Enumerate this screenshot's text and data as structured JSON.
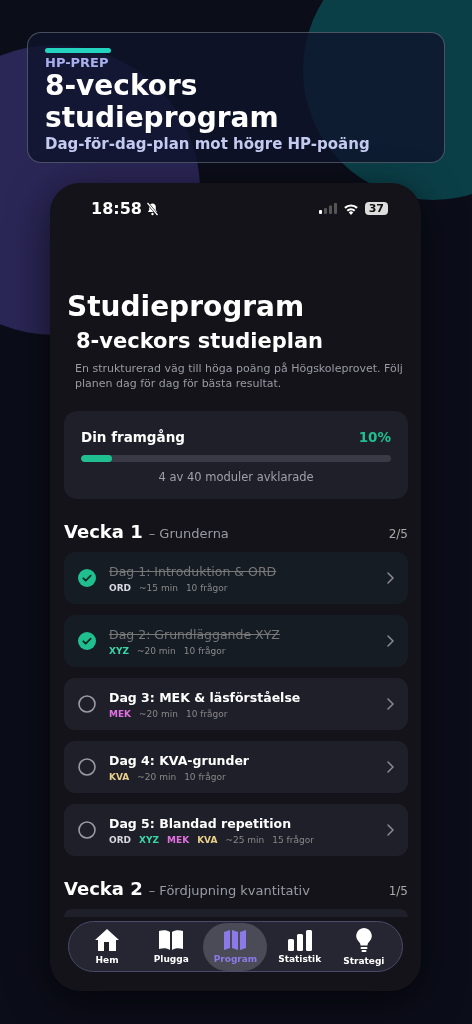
{
  "banner": {
    "eyebrow": "HP-PREP",
    "title": "8-veckors studieprogram",
    "subtitle": "Dag-för-dag-plan mot högre HP-poäng"
  },
  "status_bar": {
    "time": "18:58",
    "battery": "37"
  },
  "page": {
    "title": "Studieprogram",
    "heading": "8-veckors studieplan",
    "description": "En strukturerad väg till höga poäng på Högskoleprovet. Följ planen dag för dag för bästa resultat."
  },
  "progress": {
    "label": "Din framgång",
    "percent": "10%",
    "level": 0.1,
    "summary": "4 av 40 moduler avklarade"
  },
  "weeks": [
    {
      "title": "Vecka 1",
      "subtitle": "– Grunderna",
      "count": "2/5",
      "days": [
        {
          "title": "Dag 1: Introduktion & ORD",
          "done": true,
          "tags": [
            {
              "label": "ORD",
              "color": "#d8d8e0"
            }
          ],
          "duration": "~15 min",
          "questions": "10 frågor"
        },
        {
          "title": "Dag 2: Grundläggande XYZ",
          "done": true,
          "tags": [
            {
              "label": "XYZ",
              "color": "#3ad6a8"
            }
          ],
          "duration": "~20 min",
          "questions": "10 frågor"
        },
        {
          "title": "Dag 3: MEK & läsförståelse",
          "done": false,
          "tags": [
            {
              "label": "MEK",
              "color": "#e070e0"
            }
          ],
          "duration": "~20 min",
          "questions": "10 frågor"
        },
        {
          "title": "Dag 4: KVA-grunder",
          "done": false,
          "tags": [
            {
              "label": "KVA",
              "color": "#e8d08a"
            }
          ],
          "duration": "~20 min",
          "questions": "10 frågor"
        },
        {
          "title": "Dag 5: Blandad repetition",
          "done": false,
          "tags": [
            {
              "label": "ORD",
              "color": "#d8d8e0"
            },
            {
              "label": "XYZ",
              "color": "#3ad6a8"
            },
            {
              "label": "MEK",
              "color": "#e070e0"
            },
            {
              "label": "KVA",
              "color": "#e8d08a"
            }
          ],
          "duration": "~25 min",
          "questions": "15 frågor"
        }
      ]
    },
    {
      "title": "Vecka 2",
      "subtitle": "– Fördjupning kvantitativ",
      "count": "1/5"
    }
  ],
  "tab_bar": [
    {
      "label": "Hem",
      "selected": false
    },
    {
      "label": "Plugga",
      "selected": false
    },
    {
      "label": "Program",
      "selected": true
    },
    {
      "label": "Statistik",
      "selected": false
    },
    {
      "label": "Strategi",
      "selected": false
    }
  ]
}
